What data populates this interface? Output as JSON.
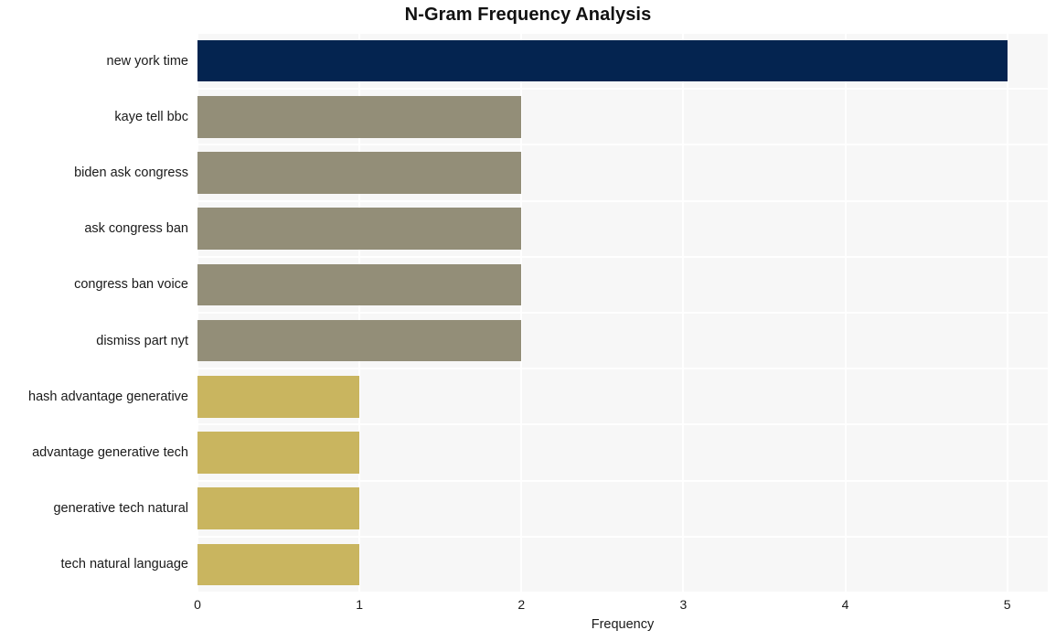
{
  "chart_data": {
    "type": "bar",
    "orientation": "horizontal",
    "title": "N-Gram Frequency Analysis",
    "xlabel": "Frequency",
    "ylabel": "",
    "categories": [
      "new york time",
      "kaye tell bbc",
      "biden ask congress",
      "ask congress ban",
      "congress ban voice",
      "dismiss part nyt",
      "hash advantage generative",
      "advantage generative tech",
      "generative tech natural",
      "tech natural language"
    ],
    "values": [
      5,
      2,
      2,
      2,
      2,
      2,
      1,
      1,
      1,
      1
    ],
    "bar_colors": [
      "#042450",
      "#938e78",
      "#938e78",
      "#938e78",
      "#938e78",
      "#938e78",
      "#c9b55f",
      "#c9b55f",
      "#c9b55f",
      "#c9b55f"
    ],
    "xlim": [
      0,
      5.25
    ],
    "xticks": [
      0,
      1,
      2,
      3,
      4,
      5
    ],
    "xticklabels": [
      "0",
      "1",
      "2",
      "3",
      "4",
      "5"
    ],
    "grid": true,
    "grid_color": "#ffffff",
    "plot_background": "#f7f7f7",
    "figure_background": "#ffffff",
    "legend": null
  }
}
